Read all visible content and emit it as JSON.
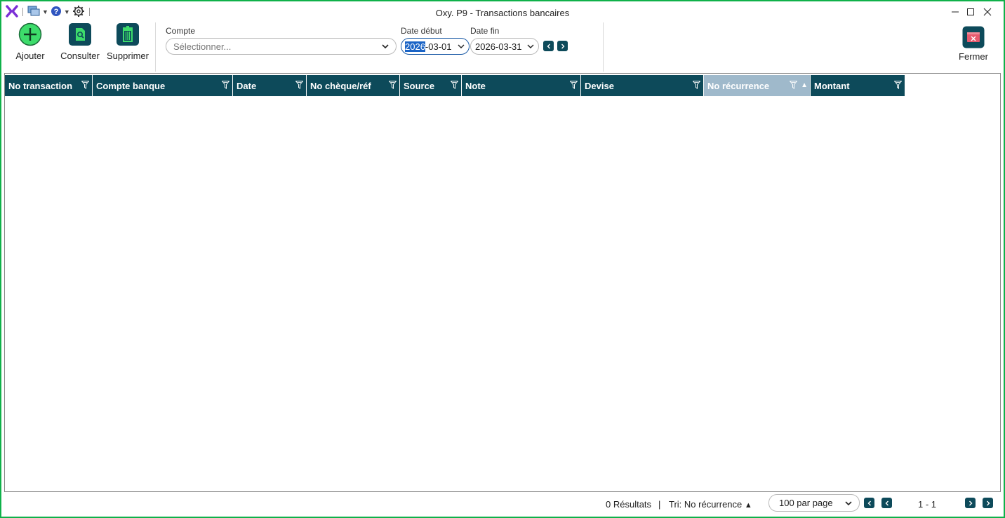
{
  "window": {
    "title": "Oxy. P9 - Transactions bancaires"
  },
  "quick_access": {
    "icons": [
      "oxygen-logo-icon",
      "windows-icon",
      "help-icon",
      "gear-icon"
    ]
  },
  "toolbar": {
    "add_label": "Ajouter",
    "view_label": "Consulter",
    "delete_label": "Supprimer",
    "close_label": "Fermer"
  },
  "filters": {
    "account_label": "Compte",
    "account_placeholder": "Sélectionner...",
    "start_label": "Date début",
    "start_value_selected": "2026",
    "start_value_rest": "-03-01",
    "end_label": "Date fin",
    "end_value": "2026-03-31"
  },
  "table": {
    "columns": [
      {
        "label": "No transaction",
        "width": 125,
        "active": false
      },
      {
        "label": "Compte banque",
        "width": 200,
        "active": false
      },
      {
        "label": "Date",
        "width": 105,
        "active": false
      },
      {
        "label": "No chèque/réf",
        "width": 133,
        "active": false
      },
      {
        "label": "Source",
        "width": 88,
        "active": false
      },
      {
        "label": "Note",
        "width": 170,
        "active": false
      },
      {
        "label": "Devise",
        "width": 175,
        "active": false
      },
      {
        "label": "No récurrence",
        "width": 152,
        "active": true
      },
      {
        "label": "Montant",
        "width": 135,
        "active": false
      }
    ],
    "rows": []
  },
  "status": {
    "results": "0 Résultats",
    "divider": "|",
    "sort": "Tri: No récurrence",
    "sort_arrow": "▲",
    "per_page": "100 par page",
    "range": "1 - 1"
  },
  "colors": {
    "header": "#0d4a5a",
    "header_active": "#9fb9cb",
    "frame": "#0fb14a",
    "add_button": "#3ddc6b",
    "close_icon": "#e65a6e"
  }
}
